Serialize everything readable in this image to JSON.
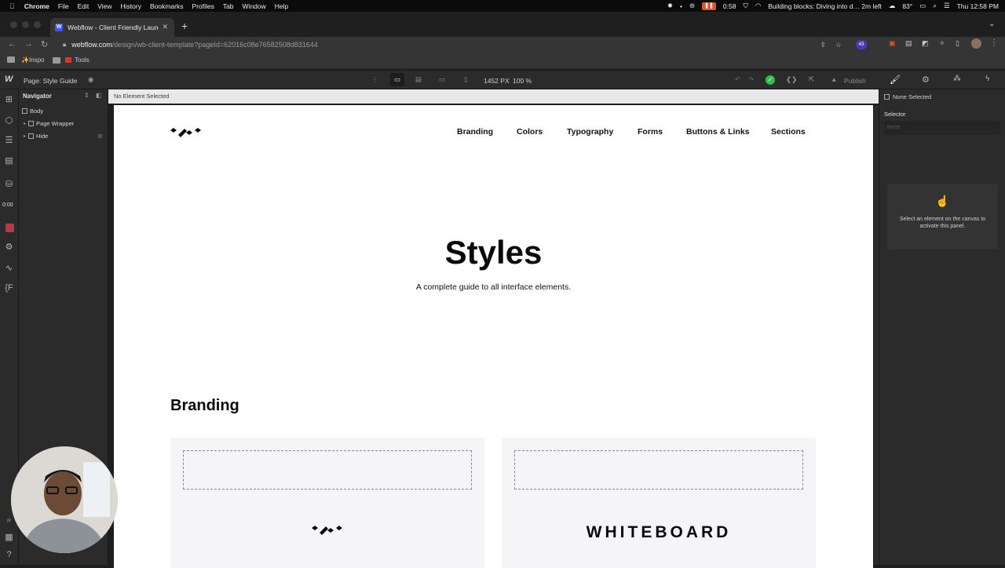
{
  "menubar": {
    "app_name": "Chrome",
    "menus": [
      "File",
      "Edit",
      "View",
      "History",
      "Bookmarks",
      "Profiles",
      "Tab",
      "Window",
      "Help"
    ],
    "recording_time": "0:58",
    "now_playing": "Building blocks: Diving into d… 2m left",
    "weather": "83°",
    "clock": "Thu 12:58 PM"
  },
  "browser": {
    "tab_title": "Webflow - Client Friendly Laun",
    "url_host": "webflow.com",
    "url_path": "/design/wb-client-template?pageId=62016c08e76582508d831644",
    "extension_badge": "43",
    "bookmarks": [
      "✨Inspo",
      "Tools"
    ]
  },
  "webflow": {
    "page_label": "Page: Style Guide",
    "viewport_width": "1452 PX",
    "zoom": "100 %",
    "publish_label": "Publish",
    "timer": "0:00",
    "navigator": {
      "title": "Navigator",
      "items": [
        "Body",
        "Page Wrapper",
        "Hide"
      ]
    },
    "canvas_status": "No Element Selected",
    "right_panel": {
      "selection": "None Selected",
      "selector_label": "Selector",
      "selector_placeholder": "None",
      "hint": "Select an element on the canvas to activate this panel."
    }
  },
  "site": {
    "nav_links": [
      "Branding",
      "Colors",
      "Typography",
      "Forms",
      "Buttons & Links",
      "Sections"
    ],
    "hero_title": "Styles",
    "hero_subtitle": "A complete guide to all interface elements.",
    "section_title": "Branding",
    "wordmark": "WHITEBOARD"
  }
}
